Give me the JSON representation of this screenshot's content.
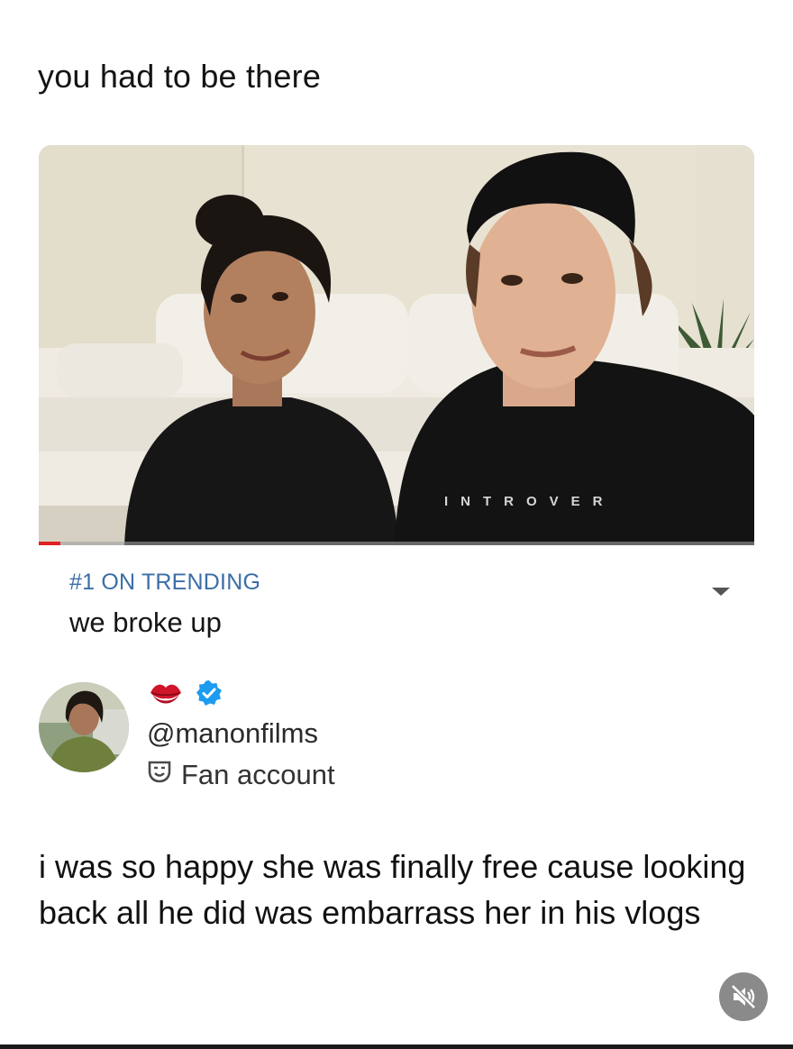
{
  "post": {
    "caption": "you had to be there"
  },
  "video": {
    "shirt_text": "INTROVER",
    "progress_fraction": 0.03,
    "trending_label": "#1 ON TRENDING",
    "title": "we broke up"
  },
  "account": {
    "handle": "@manonfilms",
    "label": "Fan account",
    "badge_icons": [
      "lips-icon",
      "verified-badge-icon"
    ],
    "label_icon": "theater-masks-icon"
  },
  "comment": {
    "text": "i was so happy she was finally free cause looking back all he did was embarrass her in his vlogs"
  },
  "controls": {
    "mute_icon": "muted-speaker-icon"
  },
  "colors": {
    "trending": "#3b6ea8",
    "verified": "#1d9bf0",
    "progress": "#e02020"
  }
}
